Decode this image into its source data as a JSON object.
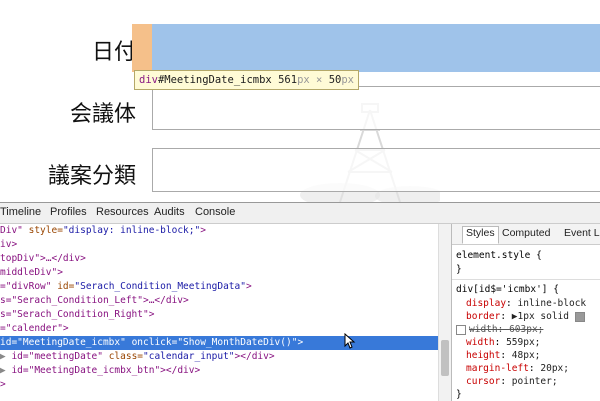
{
  "form": {
    "labels": [
      "日付",
      "会議体",
      "議案分類"
    ]
  },
  "tooltip": {
    "tag": "div",
    "id": "#MeetingDate_icmbx",
    "width": "561",
    "height": "50",
    "unit": "px",
    "times": "×"
  },
  "devtools": {
    "tabs": [
      "Timeline",
      "Profiles",
      "Resources",
      "Audits",
      "Console"
    ],
    "elements": [
      {
        "pre": "Div\"",
        "attr": " style=",
        "val": "\"display: inline-block;\"",
        "post": ">"
      },
      {
        "pre": "iv>",
        "attr": "",
        "val": "",
        "post": ""
      },
      {
        "pre": "topDiv\">…</div>",
        "attr": "",
        "val": "",
        "post": ""
      },
      {
        "pre": "middleDiv\">",
        "attr": "",
        "val": "",
        "post": ""
      },
      {
        "pre": "=\"divRow\"",
        "attr": " id=",
        "val": "\"Serach_Condition_MeetingData\"",
        "post": ">"
      },
      {
        "pre": "s=\"Serach_Condition_Left\">…</div>",
        "attr": "",
        "val": "",
        "post": ""
      },
      {
        "pre": "s=\"Serach_Condition_Right\">",
        "attr": "",
        "val": "",
        "post": ""
      },
      {
        "pre": "=\"calender\">",
        "attr": "",
        "val": "",
        "post": ""
      },
      {
        "pre": "id=\"MeetingDate_icmbx\"",
        "attr": " onclick=",
        "val": "\"Show_MonthDateDiv()\"",
        "post": ">"
      },
      {
        "pre": " id=\"meetingDate\"",
        "attr": " class=",
        "val": "\"calendar_input\"",
        "post": "></div>"
      },
      {
        "pre": " id=\"MeetingDate_icmbx_btn\">",
        "attr": "",
        "val": "",
        "post": "</div>"
      },
      {
        "pre": ">",
        "attr": "",
        "val": "",
        "post": ""
      }
    ],
    "sidebar_tabs": [
      "Styles",
      "Computed",
      "Event Li"
    ],
    "element_style": "element.style {",
    "element_style_close": "}",
    "rule_selector": "div[id$='icmbx'] {",
    "props": [
      {
        "name": "display",
        "value": "inline-block"
      },
      {
        "name": "border",
        "value": "▶1px solid"
      },
      {
        "name": "width",
        "value": "603px;"
      },
      {
        "name": "width",
        "value": "559px;"
      },
      {
        "name": "height",
        "value": "48px;"
      },
      {
        "name": "margin-left",
        "value": "20px;"
      },
      {
        "name": "cursor",
        "value": "pointer;"
      }
    ],
    "rule_close": "}"
  },
  "colors": {
    "highlight_content": "#9fc3ea",
    "highlight_margin": "#f5c08a",
    "selected_row": "#3879d9",
    "tooltip_bg": "#fffbd6"
  }
}
